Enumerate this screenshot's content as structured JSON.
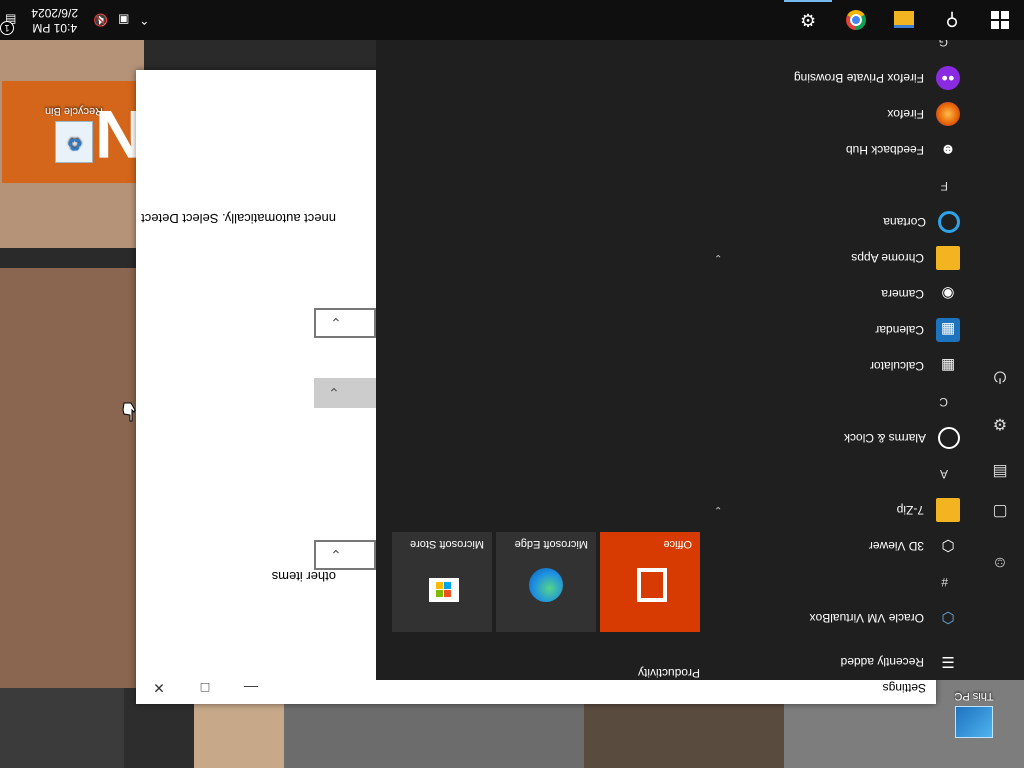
{
  "desktop": {
    "icons": [
      {
        "label": "This PC"
      },
      {
        "label": "Recycle Bin"
      }
    ],
    "recycle_letter": "N"
  },
  "settings": {
    "title": "Settings",
    "text_1": "nnect automatically. Select Detect",
    "text_2": "other items"
  },
  "start_menu": {
    "recently_added_label": "Recently added",
    "apps": [
      {
        "label": "Oracle VM VirtualBox",
        "icon": "virtualbox-icon",
        "color": "#3a6fb4"
      },
      {
        "label": "3D Viewer",
        "icon": "3d-viewer-icon",
        "color": "#1f1f1f"
      },
      {
        "label": "7-Zip",
        "icon": "folder-icon",
        "color": "#f2b521"
      },
      {
        "label": "Alarms & Clock",
        "icon": "clock-icon",
        "color": "#1f1f1f"
      },
      {
        "label": "Calculator",
        "icon": "calculator-icon",
        "color": "#1f1f1f"
      },
      {
        "label": "Calendar",
        "icon": "calendar-icon",
        "color": "#1e73be"
      },
      {
        "label": "Camera",
        "icon": "camera-icon",
        "color": "#1f1f1f"
      },
      {
        "label": "Chrome Apps",
        "icon": "folder-icon",
        "color": "#f2b521"
      },
      {
        "label": "Cortana",
        "icon": "cortana-icon",
        "color": "#1f1f1f"
      },
      {
        "label": "Feedback Hub",
        "icon": "feedback-icon",
        "color": "#1f1f1f"
      },
      {
        "label": "Firefox",
        "icon": "firefox-icon",
        "color": "#e66000"
      },
      {
        "label": "Firefox Private Browsing",
        "icon": "firefox-private-icon",
        "color": "#8a2be2"
      }
    ],
    "letters": [
      "#",
      "A",
      "C",
      "F",
      "G"
    ],
    "tiles_group": "Productivity",
    "tiles": [
      {
        "label": "Office",
        "color": "#d83b01"
      },
      {
        "label": "Microsoft Edge",
        "color": "#323232"
      },
      {
        "label": "Microsoft Store",
        "color": "#323232"
      }
    ]
  },
  "taskbar": {
    "clock_time": "4:01 PM",
    "clock_date": "2/6/2024",
    "tray_notification_count": "1"
  }
}
